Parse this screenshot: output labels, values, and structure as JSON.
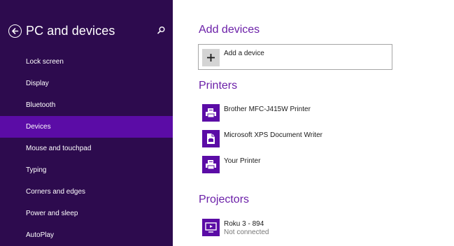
{
  "sidebar": {
    "title": "PC and devices",
    "items": [
      {
        "label": "Lock screen"
      },
      {
        "label": "Display"
      },
      {
        "label": "Bluetooth"
      },
      {
        "label": "Devices"
      },
      {
        "label": "Mouse and touchpad"
      },
      {
        "label": "Typing"
      },
      {
        "label": "Corners and edges"
      },
      {
        "label": "Power and sleep"
      },
      {
        "label": "AutoPlay"
      }
    ],
    "selected": "Devices"
  },
  "main": {
    "add_devices": {
      "title": "Add devices",
      "button_label": "Add a device"
    },
    "printers": {
      "title": "Printers",
      "items": [
        {
          "name": "Brother MFC-J415W Printer",
          "icon": "printer-icon"
        },
        {
          "name": "Microsoft XPS Document Writer",
          "icon": "document-printer-icon"
        },
        {
          "name": "Your Printer",
          "icon": "printer-icon"
        }
      ]
    },
    "projectors": {
      "title": "Projectors",
      "items": [
        {
          "name": "Roku 3 - 894",
          "status": "Not connected",
          "icon": "projector-icon"
        }
      ]
    }
  },
  "colors": {
    "sidebar_bg": "#2d0b4e",
    "selected_bg": "#5b0ca6",
    "accent": "#6b1fa8",
    "icon_tile": "#5b0ca6"
  }
}
